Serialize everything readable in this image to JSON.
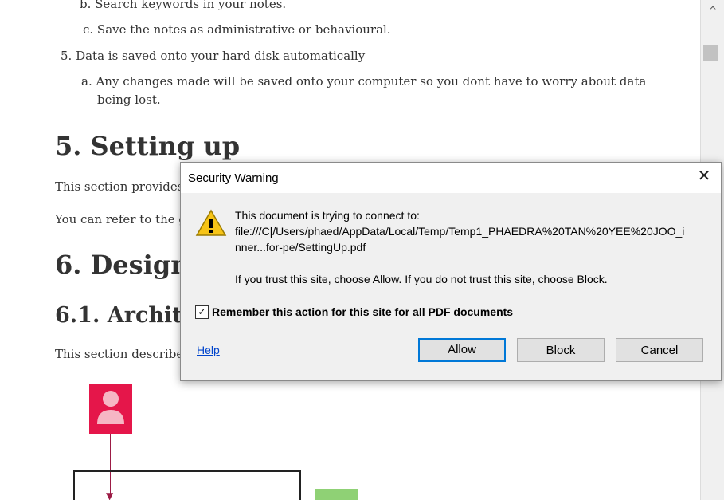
{
  "document": {
    "lines": [
      "b.  Search keywords in your notes.",
      "c.  Save the notes as administrative or behavioural.",
      "5.  Data is saved onto your hard disk automatically",
      "a.  Any changes made will be saved onto your computer so you dont have to worry about data",
      "being lost.",
      "This section provides",
      "You can refer to the g",
      "This section describes"
    ],
    "headings": {
      "setting_up": "5. Setting up",
      "design": "6. Design",
      "architecture": "6.1. Architec"
    }
  },
  "scrollbar": {
    "up_glyph": "^"
  },
  "dialog": {
    "title": "Security Warning",
    "close_glyph": "✕",
    "icon": "warning-triangle-icon",
    "message_line1": "This document is trying to connect to:",
    "message_line2": "file:///C|/Users/phaed/AppData/Local/Temp/Temp1_PHAEDRA%20TAN%20YEE%20JOO_i",
    "message_line3": "nner...for-pe/SettingUp.pdf",
    "message_line4": "If you trust this site, choose Allow. If you do not trust this site, choose Block.",
    "checkbox_checked": true,
    "checkbox_glyph": "✓",
    "checkbox_label": "Remember this action for this site for all PDF documents",
    "help_label": "Help",
    "buttons": {
      "allow": "Allow",
      "block": "Block",
      "cancel": "Cancel"
    },
    "accent_color": "#0078d7"
  },
  "diagram": {
    "icons": [
      "user-avatar-icon"
    ],
    "colors": {
      "avatar": "#e5164a",
      "connector": "#9c1b45",
      "green": "#8fd175"
    }
  }
}
